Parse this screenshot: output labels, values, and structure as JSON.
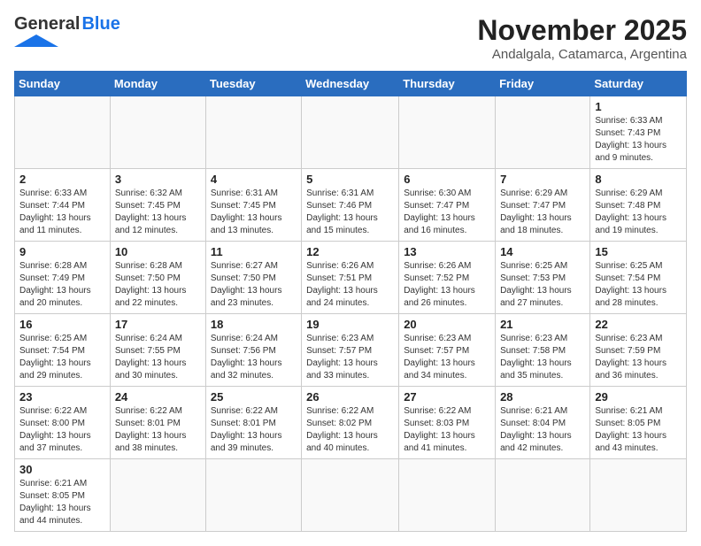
{
  "header": {
    "logo_general": "General",
    "logo_blue": "Blue",
    "month_title": "November 2025",
    "location": "Andalgala, Catamarca, Argentina"
  },
  "weekdays": [
    "Sunday",
    "Monday",
    "Tuesday",
    "Wednesday",
    "Thursday",
    "Friday",
    "Saturday"
  ],
  "days": {
    "d1": {
      "num": "1",
      "sunrise": "6:33 AM",
      "sunset": "7:43 PM",
      "daylight": "13 hours and 9 minutes."
    },
    "d2": {
      "num": "2",
      "sunrise": "6:33 AM",
      "sunset": "7:44 PM",
      "daylight": "13 hours and 11 minutes."
    },
    "d3": {
      "num": "3",
      "sunrise": "6:32 AM",
      "sunset": "7:45 PM",
      "daylight": "13 hours and 12 minutes."
    },
    "d4": {
      "num": "4",
      "sunrise": "6:31 AM",
      "sunset": "7:45 PM",
      "daylight": "13 hours and 13 minutes."
    },
    "d5": {
      "num": "5",
      "sunrise": "6:31 AM",
      "sunset": "7:46 PM",
      "daylight": "13 hours and 15 minutes."
    },
    "d6": {
      "num": "6",
      "sunrise": "6:30 AM",
      "sunset": "7:47 PM",
      "daylight": "13 hours and 16 minutes."
    },
    "d7": {
      "num": "7",
      "sunrise": "6:29 AM",
      "sunset": "7:47 PM",
      "daylight": "13 hours and 18 minutes."
    },
    "d8": {
      "num": "8",
      "sunrise": "6:29 AM",
      "sunset": "7:48 PM",
      "daylight": "13 hours and 19 minutes."
    },
    "d9": {
      "num": "9",
      "sunrise": "6:28 AM",
      "sunset": "7:49 PM",
      "daylight": "13 hours and 20 minutes."
    },
    "d10": {
      "num": "10",
      "sunrise": "6:28 AM",
      "sunset": "7:50 PM",
      "daylight": "13 hours and 22 minutes."
    },
    "d11": {
      "num": "11",
      "sunrise": "6:27 AM",
      "sunset": "7:50 PM",
      "daylight": "13 hours and 23 minutes."
    },
    "d12": {
      "num": "12",
      "sunrise": "6:26 AM",
      "sunset": "7:51 PM",
      "daylight": "13 hours and 24 minutes."
    },
    "d13": {
      "num": "13",
      "sunrise": "6:26 AM",
      "sunset": "7:52 PM",
      "daylight": "13 hours and 26 minutes."
    },
    "d14": {
      "num": "14",
      "sunrise": "6:25 AM",
      "sunset": "7:53 PM",
      "daylight": "13 hours and 27 minutes."
    },
    "d15": {
      "num": "15",
      "sunrise": "6:25 AM",
      "sunset": "7:54 PM",
      "daylight": "13 hours and 28 minutes."
    },
    "d16": {
      "num": "16",
      "sunrise": "6:25 AM",
      "sunset": "7:54 PM",
      "daylight": "13 hours and 29 minutes."
    },
    "d17": {
      "num": "17",
      "sunrise": "6:24 AM",
      "sunset": "7:55 PM",
      "daylight": "13 hours and 30 minutes."
    },
    "d18": {
      "num": "18",
      "sunrise": "6:24 AM",
      "sunset": "7:56 PM",
      "daylight": "13 hours and 32 minutes."
    },
    "d19": {
      "num": "19",
      "sunrise": "6:23 AM",
      "sunset": "7:57 PM",
      "daylight": "13 hours and 33 minutes."
    },
    "d20": {
      "num": "20",
      "sunrise": "6:23 AM",
      "sunset": "7:57 PM",
      "daylight": "13 hours and 34 minutes."
    },
    "d21": {
      "num": "21",
      "sunrise": "6:23 AM",
      "sunset": "7:58 PM",
      "daylight": "13 hours and 35 minutes."
    },
    "d22": {
      "num": "22",
      "sunrise": "6:23 AM",
      "sunset": "7:59 PM",
      "daylight": "13 hours and 36 minutes."
    },
    "d23": {
      "num": "23",
      "sunrise": "6:22 AM",
      "sunset": "8:00 PM",
      "daylight": "13 hours and 37 minutes."
    },
    "d24": {
      "num": "24",
      "sunrise": "6:22 AM",
      "sunset": "8:01 PM",
      "daylight": "13 hours and 38 minutes."
    },
    "d25": {
      "num": "25",
      "sunrise": "6:22 AM",
      "sunset": "8:01 PM",
      "daylight": "13 hours and 39 minutes."
    },
    "d26": {
      "num": "26",
      "sunrise": "6:22 AM",
      "sunset": "8:02 PM",
      "daylight": "13 hours and 40 minutes."
    },
    "d27": {
      "num": "27",
      "sunrise": "6:22 AM",
      "sunset": "8:03 PM",
      "daylight": "13 hours and 41 minutes."
    },
    "d28": {
      "num": "28",
      "sunrise": "6:21 AM",
      "sunset": "8:04 PM",
      "daylight": "13 hours and 42 minutes."
    },
    "d29": {
      "num": "29",
      "sunrise": "6:21 AM",
      "sunset": "8:05 PM",
      "daylight": "13 hours and 43 minutes."
    },
    "d30": {
      "num": "30",
      "sunrise": "6:21 AM",
      "sunset": "8:05 PM",
      "daylight": "13 hours and 44 minutes."
    }
  },
  "labels": {
    "sunrise": "Sunrise:",
    "sunset": "Sunset:",
    "daylight": "Daylight:"
  }
}
